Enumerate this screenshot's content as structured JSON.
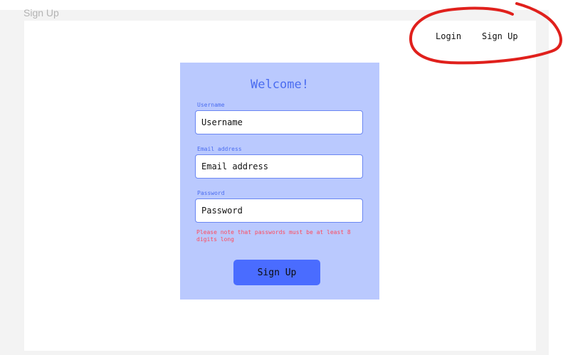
{
  "page": {
    "label": "Sign Up"
  },
  "nav": {
    "login_label": "Login",
    "signup_label": "Sign Up"
  },
  "form": {
    "title": "Welcome!",
    "username": {
      "label": "Username",
      "placeholder": "Username"
    },
    "email": {
      "label": "Email address",
      "placeholder": "Email address"
    },
    "password": {
      "label": "Password",
      "placeholder": "Password"
    },
    "password_note": "Please note that passwords must be at least 8 digits long",
    "submit_label": "Sign Up"
  },
  "colors": {
    "card_background": "#bac9fe",
    "accent": "#4a6cf0",
    "button": "#4a6cff",
    "error": "#ff4a5c",
    "annotation": "#e0201c"
  }
}
